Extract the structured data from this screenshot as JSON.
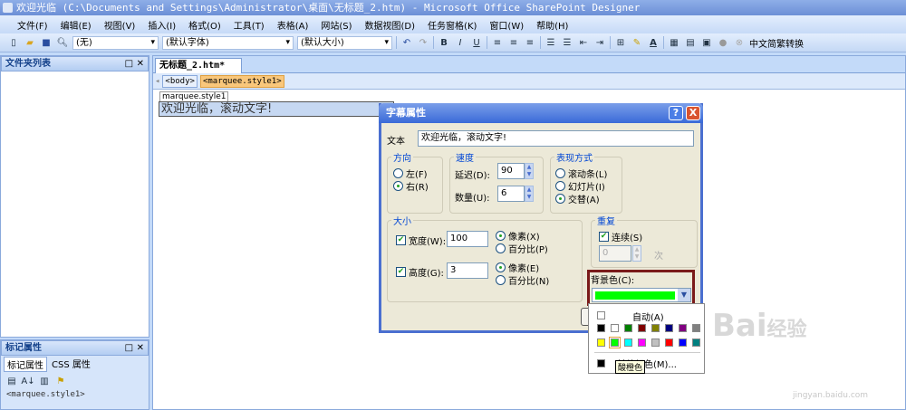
{
  "window": {
    "title": "欢迎光临 (C:\\Documents and Settings\\Administrator\\桌面\\无标题_2.htm) - Microsoft Office SharePoint Designer"
  },
  "menu": [
    "文件(F)",
    "编辑(E)",
    "视图(V)",
    "插入(I)",
    "格式(O)",
    "工具(T)",
    "表格(A)",
    "网站(S)",
    "数据视图(D)",
    "任务窗格(K)",
    "窗口(W)",
    "帮助(H)"
  ],
  "toolbar": {
    "style": "(无)",
    "font": "(默认字体)",
    "size": "(默认大小)",
    "bold": "B",
    "italic": "I",
    "underline": "U",
    "font_color": "A",
    "convert": "中文简繁转换"
  },
  "folder_panel": {
    "title": "文件夹列表"
  },
  "tag_panel": {
    "title": "标记属性",
    "tabs": [
      "标记属性",
      "CSS 属性"
    ],
    "tag": "<marquee.style1>"
  },
  "editor": {
    "tab": "无标题_2.htm*",
    "breadcrumb": [
      "<body>",
      "<marquee.style1>"
    ],
    "marquee_tag": "marquee.style1",
    "marquee_text": "欢迎光临，滚动文字!"
  },
  "dialog": {
    "title": "字幕属性",
    "help": "?",
    "close": "X",
    "text_label": "文本",
    "text_value": "欢迎光临，滚动文字!",
    "direction": {
      "label": "方向",
      "options": [
        "左(F)",
        "右(R)"
      ],
      "selected": 1
    },
    "speed": {
      "label": "速度",
      "delay_label": "延迟(D):",
      "delay": "90",
      "amount_label": "数量(U):",
      "amount": "6"
    },
    "behavior": {
      "label": "表现方式",
      "options": [
        "滚动条(L)",
        "幻灯片(I)",
        "交替(A)"
      ],
      "selected": 2
    },
    "size": {
      "label": "大小",
      "width_label": "宽度(W):",
      "width": "100",
      "width_unit": [
        "像素(X)",
        "百分比(P)"
      ],
      "height_label": "高度(G):",
      "height": "3",
      "height_unit": [
        "像素(E)",
        "百分比(N)"
      ]
    },
    "repeat": {
      "label": "重复",
      "continuous_label": "连续(S)",
      "count": "0",
      "times": "次"
    },
    "bgcolor": {
      "label": "背景色(C):",
      "value": "#00ff00"
    }
  },
  "color_popup": {
    "auto": "自动(A)",
    "row1": [
      "#000000",
      "#ffffff",
      "#008000",
      "#800000",
      "#808000",
      "#000080",
      "#800080",
      "#808080"
    ],
    "row2": [
      "#ffff00",
      "#00ff00",
      "#00ffff",
      "#ff00ff",
      "#c0c0c0",
      "#ff0000",
      "#0000ff",
      "#008080"
    ],
    "more": "其他颜色(M)...",
    "tooltip": "酸橙色"
  },
  "watermark": {
    "logo": "Baidu经验",
    "url": "jingyan.baidu.com"
  }
}
